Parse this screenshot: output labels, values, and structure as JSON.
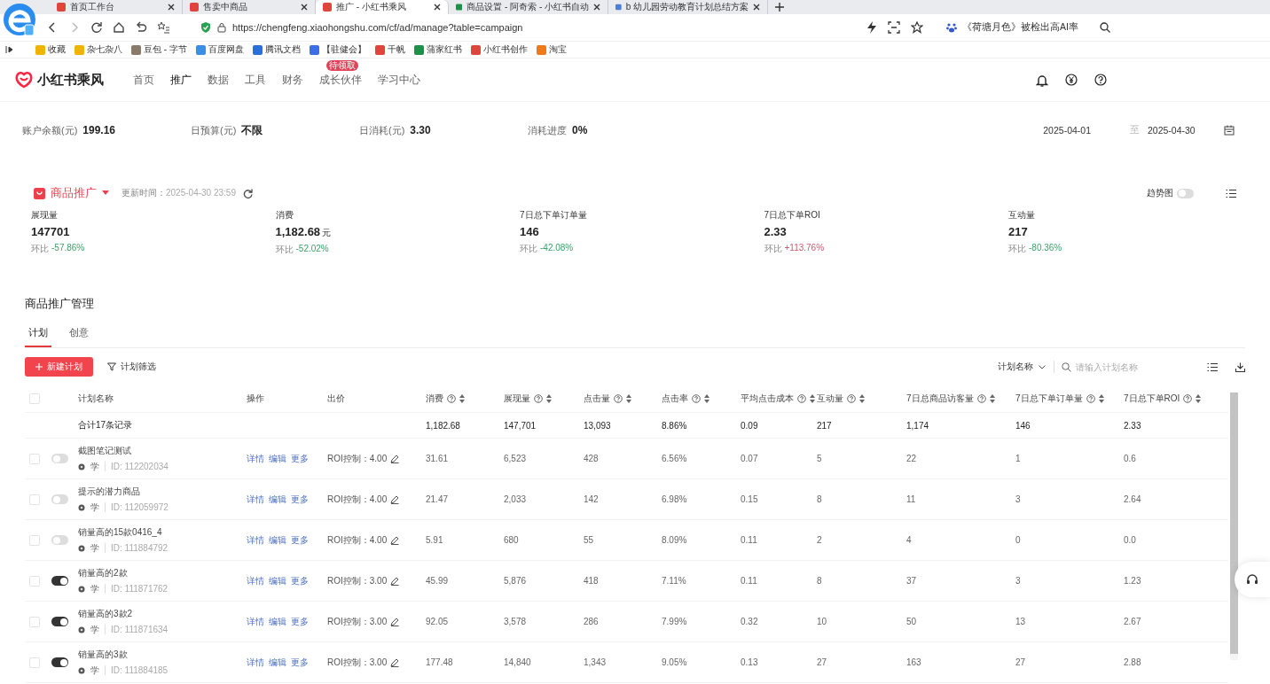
{
  "browser": {
    "tabs": [
      {
        "title": "首页工作台",
        "selected": false,
        "color": "#e0443c"
      },
      {
        "title": "售卖中商品",
        "selected": false,
        "color": "#e0443c"
      },
      {
        "title": "推广 - 小红书乘风",
        "selected": true,
        "color": "#e0443c"
      },
      {
        "title": "商品设置 - 阿奇索 - 小红书自动",
        "selected": false,
        "color": "#1f8f4a"
      },
      {
        "title": "b 幼儿园劳动教育计划总结方案",
        "selected": false,
        "color": "#4a7fd6"
      }
    ],
    "address": "https://chengfeng.xiaohongshu.com/cf/ad/manage?table=campaign",
    "search_hint": "《荷塘月色》被检出高AI率",
    "bookmarks": [
      {
        "label": "收藏",
        "color": "#f0b400"
      },
      {
        "label": "杂七杂八",
        "color": "#f0b400"
      },
      {
        "label": "豆包 - 字节",
        "color": "#8a7a6a"
      },
      {
        "label": "百度网盘",
        "color": "#3a8ee6"
      },
      {
        "label": "腾讯文档",
        "color": "#2a6fdb"
      },
      {
        "label": "【驻健会】",
        "color": "#3b6ee8"
      },
      {
        "label": "千帆",
        "color": "#e0443c"
      },
      {
        "label": "蒲家红书",
        "color": "#1f8f4a"
      },
      {
        "label": "小红书创作",
        "color": "#e0443c"
      },
      {
        "label": "淘宝",
        "color": "#f07a1a"
      }
    ]
  },
  "app": {
    "logo": "小红书乘风",
    "nav": [
      {
        "label": "首页",
        "selected": false
      },
      {
        "label": "推广",
        "selected": true
      },
      {
        "label": "数据",
        "selected": false
      },
      {
        "label": "工具",
        "selected": false
      },
      {
        "label": "财务",
        "selected": false
      },
      {
        "label": "成长伙伴",
        "selected": false,
        "badge": "待领取"
      },
      {
        "label": "学习中心",
        "selected": false
      }
    ]
  },
  "summary": [
    {
      "label": "账户余额(元)",
      "value": "199.16"
    },
    {
      "label": "日预算(元)",
      "value": "不限"
    },
    {
      "label": "日消耗(元)",
      "value": "3.30"
    },
    {
      "label": "消耗进度",
      "value": "0%"
    }
  ],
  "date_range": {
    "start": "2025-04-01",
    "separator": "至",
    "end": "2025-04-30"
  },
  "panel": {
    "title": "商品推广",
    "updated_label": "更新时间：",
    "updated": "2025-04-30 23:59",
    "trend_label": "趋势图",
    "trend_on": false,
    "metrics": [
      {
        "label": "展现量",
        "value": "147701",
        "change_label": "环比",
        "change": "-57.86%",
        "color": "#3aa36a"
      },
      {
        "label": "消费",
        "value": "1,182.68",
        "unit": "元",
        "change_label": "环比",
        "change": "-52.02%",
        "color": "#3aa36a"
      },
      {
        "label": "7日总下单订单量",
        "value": "146",
        "change_label": "环比",
        "change": "-42.08%",
        "color": "#3aa36a"
      },
      {
        "label": "7日总下单ROI",
        "value": "2.33",
        "change_label": "环比",
        "change": "+113.76%",
        "color": "#d0586e"
      },
      {
        "label": "互动量",
        "value": "217",
        "change_label": "环比",
        "change": "-80.36%",
        "color": "#3aa36a"
      }
    ]
  },
  "management": {
    "title": "商品推广管理",
    "tabs": [
      {
        "label": "计划",
        "selected": true
      },
      {
        "label": "创意",
        "selected": false
      }
    ],
    "new_button": "新建计划",
    "filter": "计划筛选",
    "search_by": "计划名称",
    "search": {
      "placeholder": "请输入计划名称"
    },
    "table": {
      "select_all_checked": false,
      "columns": [
        {
          "label": "计划名称",
          "help": false,
          "sortable": false
        },
        {
          "label": "操作",
          "help": false,
          "sortable": false
        },
        {
          "label": "出价",
          "help": false,
          "sortable": false
        },
        {
          "label": "消费",
          "help": true,
          "sortable": true
        },
        {
          "label": "展现量",
          "help": true,
          "sortable": true
        },
        {
          "label": "点击量",
          "help": true,
          "sortable": true
        },
        {
          "label": "点击率",
          "help": true,
          "sortable": true
        },
        {
          "label": "平均点击成本",
          "help": true,
          "sortable": true
        },
        {
          "label": "互动量",
          "help": true,
          "sortable": true
        },
        {
          "label": "7日总商品访客量",
          "help": true,
          "sortable": true
        },
        {
          "label": "7日总下单订单量",
          "help": true,
          "sortable": true
        },
        {
          "label": "7日总下单ROI",
          "help": true,
          "sortable": true
        }
      ],
      "total": {
        "label": "合计17条记录",
        "values": [
          "1,182.68",
          "147,701",
          "13,093",
          "8.86%",
          "0.09",
          "217",
          "1,174",
          "146",
          "2.33"
        ]
      },
      "rows": [
        {
          "checked": false,
          "on": false,
          "name": "截图笔记测试",
          "tag": "学",
          "id": "ID: 112202034",
          "actions": [
            "详情",
            "编辑",
            "更多"
          ],
          "bid": "ROI控制：4.00",
          "values": [
            "31.61",
            "6,523",
            "428",
            "6.56%",
            "0.07",
            "5",
            "22",
            "1",
            "0.6"
          ]
        },
        {
          "checked": false,
          "on": false,
          "name": "提示的潜力商品",
          "tag": "学",
          "id": "ID: 112059972",
          "actions": [
            "详情",
            "编辑",
            "更多"
          ],
          "bid": "ROI控制：4.00",
          "values": [
            "21.47",
            "2,033",
            "142",
            "6.98%",
            "0.15",
            "8",
            "11",
            "3",
            "2.64"
          ]
        },
        {
          "checked": false,
          "on": false,
          "name": "销量高的15款0416_4",
          "tag": "学",
          "id": "ID: 111884792",
          "actions": [
            "详情",
            "编辑",
            "更多"
          ],
          "bid": "ROI控制：4.00",
          "values": [
            "5.91",
            "680",
            "55",
            "8.09%",
            "0.11",
            "2",
            "4",
            "0",
            "0.0"
          ]
        },
        {
          "checked": false,
          "on": true,
          "name": "销量高的2款",
          "tag": "学",
          "id": "ID: 111871762",
          "actions": [
            "详情",
            "编辑",
            "更多"
          ],
          "bid": "ROI控制：3.00",
          "values": [
            "45.99",
            "5,876",
            "418",
            "7.11%",
            "0.11",
            "8",
            "37",
            "3",
            "1.23"
          ]
        },
        {
          "checked": false,
          "on": true,
          "name": "销量高的3款2",
          "tag": "学",
          "id": "ID: 111871634",
          "actions": [
            "详情",
            "编辑",
            "更多"
          ],
          "bid": "ROI控制：3.00",
          "values": [
            "92.05",
            "3,578",
            "286",
            "7.99%",
            "0.32",
            "10",
            "50",
            "13",
            "2.67"
          ]
        },
        {
          "checked": false,
          "on": true,
          "name": "销量高的3款",
          "tag": "学",
          "id": "ID: 111884185",
          "actions": [
            "详情",
            "编辑",
            "更多"
          ],
          "bid": "ROI控制：3.00",
          "values": [
            "177.48",
            "14,840",
            "1,343",
            "9.05%",
            "0.13",
            "27",
            "163",
            "27",
            "2.88"
          ]
        }
      ]
    }
  }
}
